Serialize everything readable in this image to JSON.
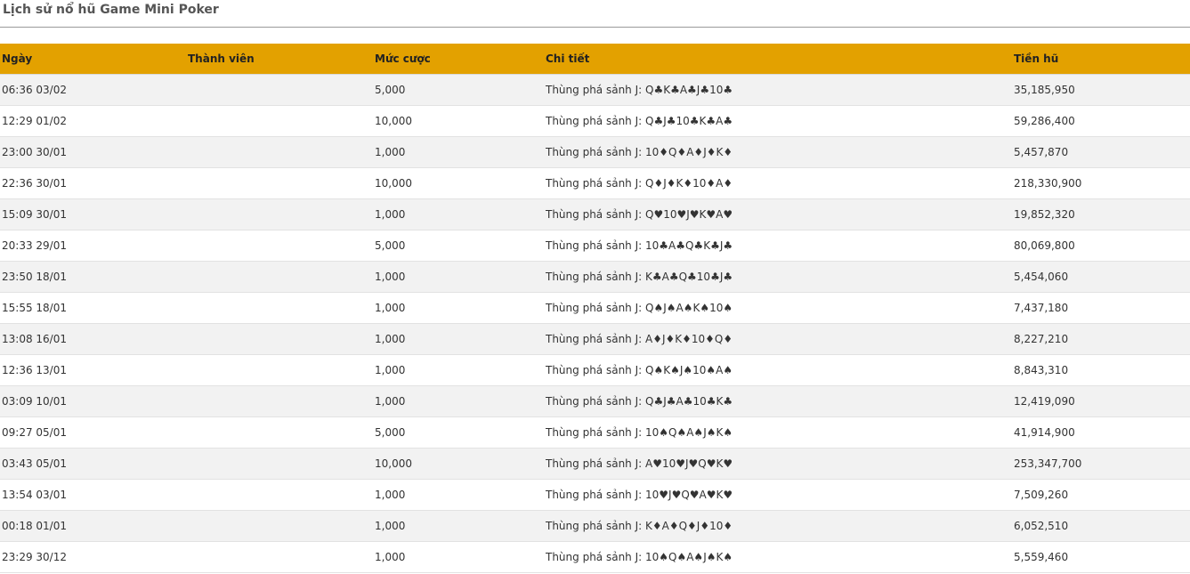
{
  "page": {
    "title": "Lịch sử nổ hũ Game Mini Poker"
  },
  "table": {
    "headers": {
      "date": "Ngày",
      "member": "Thành viên",
      "bet": "Mức cược",
      "detail": "Chi tiết",
      "jackpot": "Tiền hũ"
    },
    "rows": [
      {
        "date": "06:36 03/02",
        "member": "",
        "bet": "5,000",
        "detail": "Thùng phá sảnh J: Q♣K♣A♣J♣10♣",
        "jackpot": "35,185,950"
      },
      {
        "date": "12:29 01/02",
        "member": "",
        "bet": "10,000",
        "detail": "Thùng phá sảnh J: Q♣J♣10♣K♣A♣",
        "jackpot": "59,286,400"
      },
      {
        "date": "23:00 30/01",
        "member": "",
        "bet": "1,000",
        "detail": "Thùng phá sảnh J: 10♦Q♦A♦J♦K♦",
        "jackpot": "5,457,870"
      },
      {
        "date": "22:36 30/01",
        "member": "",
        "bet": "10,000",
        "detail": "Thùng phá sảnh J: Q♦J♦K♦10♦A♦",
        "jackpot": "218,330,900"
      },
      {
        "date": "15:09 30/01",
        "member": "",
        "bet": "1,000",
        "detail": "Thùng phá sảnh J: Q♥10♥J♥K♥A♥",
        "jackpot": "19,852,320"
      },
      {
        "date": "20:33 29/01",
        "member": "",
        "bet": "5,000",
        "detail": "Thùng phá sảnh J: 10♣A♣Q♣K♣J♣",
        "jackpot": "80,069,800"
      },
      {
        "date": "23:50 18/01",
        "member": "",
        "bet": "1,000",
        "detail": "Thùng phá sảnh J: K♣A♣Q♣10♣J♣",
        "jackpot": "5,454,060"
      },
      {
        "date": "15:55 18/01",
        "member": "",
        "bet": "1,000",
        "detail": "Thùng phá sảnh J: Q♠J♠A♠K♠10♠",
        "jackpot": "7,437,180"
      },
      {
        "date": "13:08 16/01",
        "member": "",
        "bet": "1,000",
        "detail": "Thùng phá sảnh J: A♦J♦K♦10♦Q♦",
        "jackpot": "8,227,210"
      },
      {
        "date": "12:36 13/01",
        "member": "",
        "bet": "1,000",
        "detail": "Thùng phá sảnh J: Q♠K♠J♠10♠A♠",
        "jackpot": "8,843,310"
      },
      {
        "date": "03:09 10/01",
        "member": "",
        "bet": "1,000",
        "detail": "Thùng phá sảnh J: Q♣J♣A♣10♣K♣",
        "jackpot": "12,419,090"
      },
      {
        "date": "09:27 05/01",
        "member": "",
        "bet": "5,000",
        "detail": "Thùng phá sảnh J: 10♠Q♠A♠J♠K♠",
        "jackpot": "41,914,900"
      },
      {
        "date": "03:43 05/01",
        "member": "",
        "bet": "10,000",
        "detail": "Thùng phá sảnh J: A♥10♥J♥Q♥K♥",
        "jackpot": "253,347,700"
      },
      {
        "date": "13:54 03/01",
        "member": "",
        "bet": "1,000",
        "detail": "Thùng phá sảnh J: 10♥J♥Q♥A♥K♥",
        "jackpot": "7,509,260"
      },
      {
        "date": "00:18 01/01",
        "member": "",
        "bet": "1,000",
        "detail": "Thùng phá sảnh J: K♦A♦Q♦J♦10♦",
        "jackpot": "6,052,510"
      },
      {
        "date": "23:29 30/12",
        "member": "",
        "bet": "1,000",
        "detail": "Thùng phá sảnh J: 10♠Q♠A♠J♠K♠",
        "jackpot": "5,559,460"
      }
    ]
  },
  "colors": {
    "header_background": "#e3a100",
    "row_odd": "#f2f2f2",
    "row_even": "#ffffff"
  }
}
